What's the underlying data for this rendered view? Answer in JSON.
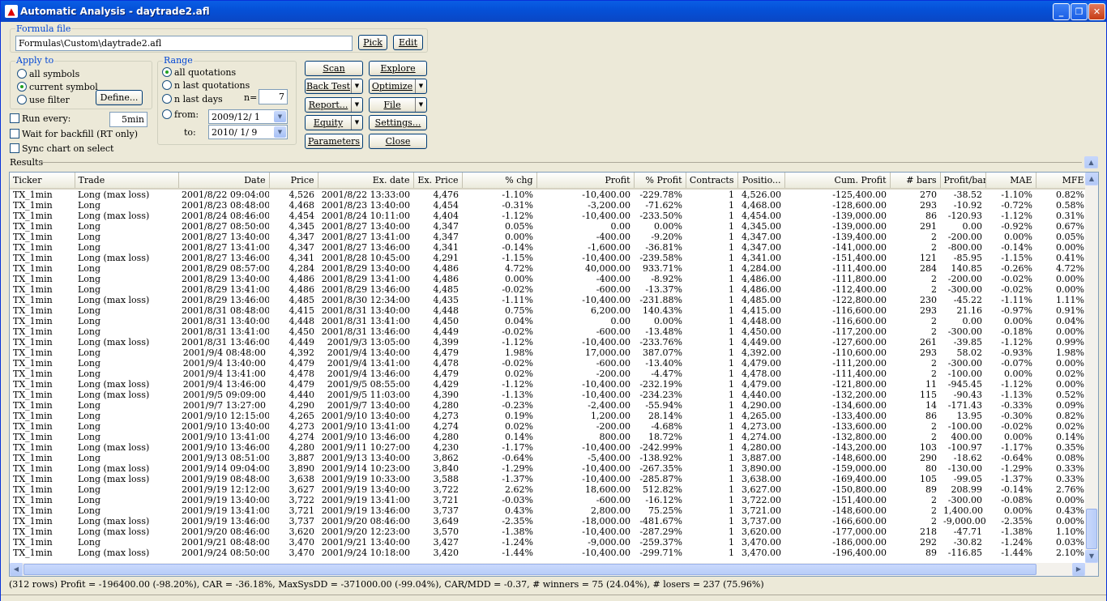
{
  "window": {
    "title": "Automatic Analysis - daytrade2.afl"
  },
  "formula": {
    "legend": "Formula file",
    "path": "Formulas\\Custom\\daytrade2.afl",
    "pick": "Pick",
    "edit": "Edit"
  },
  "apply": {
    "legend": "Apply to",
    "all": "all symbols",
    "current": "current symbol",
    "filter": "use filter",
    "define": "Define..."
  },
  "range": {
    "legend": "Range",
    "allq": "all quotations",
    "nlastq": "n last quotations",
    "nlastd": "n last days",
    "n_label": "n=",
    "n_value": "7",
    "from_label": "from:",
    "from_value": "2009/12/  1",
    "to_label": "to:",
    "to_value": "2010/  1/  9"
  },
  "actions": {
    "scan": "Scan",
    "explore": "Explore",
    "backtest": "Back Test",
    "optimize": "Optimize",
    "report": "Report...",
    "file": "File",
    "equity": "Equity",
    "settings": "Settings...",
    "parameters": "Parameters",
    "close": "Close"
  },
  "options": {
    "run_every": "Run every:",
    "run_value": "5min",
    "backfill": "Wait for backfill (RT only)",
    "sync": "Sync chart on select"
  },
  "results": {
    "label": "Results"
  },
  "columns": [
    "Ticker",
    "Trade",
    "Date",
    "Price",
    "Ex. date",
    "Ex. Price",
    "% chg",
    "Profit",
    "% Profit",
    "Contracts",
    "Positio...",
    "Cum. Profit",
    "# bars",
    "Profit/bar",
    "MAE",
    "MFE"
  ],
  "rows": [
    [
      "TX_1min",
      "Long (max loss)",
      "2001/8/22 09:04:00",
      "4,526",
      "2001/8/22 13:33:00",
      "4,476",
      "-1.10%",
      "-10,400.00",
      "-229.78%",
      "1",
      "4,526.00",
      "-125,400.00",
      "270",
      "-38.52",
      "-1.10%",
      "0.82%"
    ],
    [
      "TX_1min",
      "Long",
      "2001/8/23 08:48:00",
      "4,468",
      "2001/8/23 13:40:00",
      "4,454",
      "-0.31%",
      "-3,200.00",
      "-71.62%",
      "1",
      "4,468.00",
      "-128,600.00",
      "293",
      "-10.92",
      "-0.72%",
      "0.58%"
    ],
    [
      "TX_1min",
      "Long (max loss)",
      "2001/8/24 08:46:00",
      "4,454",
      "2001/8/24 10:11:00",
      "4,404",
      "-1.12%",
      "-10,400.00",
      "-233.50%",
      "1",
      "4,454.00",
      "-139,000.00",
      "86",
      "-120.93",
      "-1.12%",
      "0.31%"
    ],
    [
      "TX_1min",
      "Long",
      "2001/8/27 08:50:00",
      "4,345",
      "2001/8/27 13:40:00",
      "4,347",
      "0.05%",
      "0.00",
      "0.00%",
      "1",
      "4,345.00",
      "-139,000.00",
      "291",
      "0.00",
      "-0.92%",
      "0.67%"
    ],
    [
      "TX_1min",
      "Long",
      "2001/8/27 13:40:00",
      "4,347",
      "2001/8/27 13:41:00",
      "4,347",
      "0.00%",
      "-400.00",
      "-9.20%",
      "1",
      "4,347.00",
      "-139,400.00",
      "2",
      "-200.00",
      "0.00%",
      "0.05%"
    ],
    [
      "TX_1min",
      "Long",
      "2001/8/27 13:41:00",
      "4,347",
      "2001/8/27 13:46:00",
      "4,341",
      "-0.14%",
      "-1,600.00",
      "-36.81%",
      "1",
      "4,347.00",
      "-141,000.00",
      "2",
      "-800.00",
      "-0.14%",
      "0.00%"
    ],
    [
      "TX_1min",
      "Long (max loss)",
      "2001/8/27 13:46:00",
      "4,341",
      "2001/8/28 10:45:00",
      "4,291",
      "-1.15%",
      "-10,400.00",
      "-239.58%",
      "1",
      "4,341.00",
      "-151,400.00",
      "121",
      "-85.95",
      "-1.15%",
      "0.41%"
    ],
    [
      "TX_1min",
      "Long",
      "2001/8/29 08:57:00",
      "4,284",
      "2001/8/29 13:40:00",
      "4,486",
      "4.72%",
      "40,000.00",
      "933.71%",
      "1",
      "4,284.00",
      "-111,400.00",
      "284",
      "140.85",
      "-0.26%",
      "4.72%"
    ],
    [
      "TX_1min",
      "Long",
      "2001/8/29 13:40:00",
      "4,486",
      "2001/8/29 13:41:00",
      "4,486",
      "0.00%",
      "-400.00",
      "-8.92%",
      "1",
      "4,486.00",
      "-111,800.00",
      "2",
      "-200.00",
      "-0.02%",
      "0.00%"
    ],
    [
      "TX_1min",
      "Long",
      "2001/8/29 13:41:00",
      "4,486",
      "2001/8/29 13:46:00",
      "4,485",
      "-0.02%",
      "-600.00",
      "-13.37%",
      "1",
      "4,486.00",
      "-112,400.00",
      "2",
      "-300.00",
      "-0.02%",
      "0.00%"
    ],
    [
      "TX_1min",
      "Long (max loss)",
      "2001/8/29 13:46:00",
      "4,485",
      "2001/8/30 12:34:00",
      "4,435",
      "-1.11%",
      "-10,400.00",
      "-231.88%",
      "1",
      "4,485.00",
      "-122,800.00",
      "230",
      "-45.22",
      "-1.11%",
      "1.11%"
    ],
    [
      "TX_1min",
      "Long",
      "2001/8/31 08:48:00",
      "4,415",
      "2001/8/31 13:40:00",
      "4,448",
      "0.75%",
      "6,200.00",
      "140.43%",
      "1",
      "4,415.00",
      "-116,600.00",
      "293",
      "21.16",
      "-0.97%",
      "0.91%"
    ],
    [
      "TX_1min",
      "Long",
      "2001/8/31 13:40:00",
      "4,448",
      "2001/8/31 13:41:00",
      "4,450",
      "0.04%",
      "0.00",
      "0.00%",
      "1",
      "4,448.00",
      "-116,600.00",
      "2",
      "0.00",
      "0.00%",
      "0.04%"
    ],
    [
      "TX_1min",
      "Long",
      "2001/8/31 13:41:00",
      "4,450",
      "2001/8/31 13:46:00",
      "4,449",
      "-0.02%",
      "-600.00",
      "-13.48%",
      "1",
      "4,450.00",
      "-117,200.00",
      "2",
      "-300.00",
      "-0.18%",
      "0.00%"
    ],
    [
      "TX_1min",
      "Long (max loss)",
      "2001/8/31 13:46:00",
      "4,449",
      "2001/9/3 13:05:00",
      "4,399",
      "-1.12%",
      "-10,400.00",
      "-233.76%",
      "1",
      "4,449.00",
      "-127,600.00",
      "261",
      "-39.85",
      "-1.12%",
      "0.99%"
    ],
    [
      "TX_1min",
      "Long",
      "2001/9/4 08:48:00",
      "4,392",
      "2001/9/4 13:40:00",
      "4,479",
      "1.98%",
      "17,000.00",
      "387.07%",
      "1",
      "4,392.00",
      "-110,600.00",
      "293",
      "58.02",
      "-0.93%",
      "1.98%"
    ],
    [
      "TX_1min",
      "Long",
      "2001/9/4 13:40:00",
      "4,479",
      "2001/9/4 13:41:00",
      "4,478",
      "-0.02%",
      "-600.00",
      "-13.40%",
      "1",
      "4,479.00",
      "-111,200.00",
      "2",
      "-300.00",
      "-0.07%",
      "0.00%"
    ],
    [
      "TX_1min",
      "Long",
      "2001/9/4 13:41:00",
      "4,478",
      "2001/9/4 13:46:00",
      "4,479",
      "0.02%",
      "-200.00",
      "-4.47%",
      "1",
      "4,478.00",
      "-111,400.00",
      "2",
      "-100.00",
      "0.00%",
      "0.02%"
    ],
    [
      "TX_1min",
      "Long (max loss)",
      "2001/9/4 13:46:00",
      "4,479",
      "2001/9/5 08:55:00",
      "4,429",
      "-1.12%",
      "-10,400.00",
      "-232.19%",
      "1",
      "4,479.00",
      "-121,800.00",
      "11",
      "-945.45",
      "-1.12%",
      "0.00%"
    ],
    [
      "TX_1min",
      "Long (max loss)",
      "2001/9/5 09:09:00",
      "4,440",
      "2001/9/5 11:03:00",
      "4,390",
      "-1.13%",
      "-10,400.00",
      "-234.23%",
      "1",
      "4,440.00",
      "-132,200.00",
      "115",
      "-90.43",
      "-1.13%",
      "0.52%"
    ],
    [
      "TX_1min",
      "Long",
      "2001/9/7 13:27:00",
      "4,290",
      "2001/9/7 13:40:00",
      "4,280",
      "-0.23%",
      "-2,400.00",
      "-55.94%",
      "1",
      "4,290.00",
      "-134,600.00",
      "14",
      "-171.43",
      "-0.33%",
      "0.09%"
    ],
    [
      "TX_1min",
      "Long",
      "2001/9/10 12:15:00",
      "4,265",
      "2001/9/10 13:40:00",
      "4,273",
      "0.19%",
      "1,200.00",
      "28.14%",
      "1",
      "4,265.00",
      "-133,400.00",
      "86",
      "13.95",
      "-0.30%",
      "0.82%"
    ],
    [
      "TX_1min",
      "Long",
      "2001/9/10 13:40:00",
      "4,273",
      "2001/9/10 13:41:00",
      "4,274",
      "0.02%",
      "-200.00",
      "-4.68%",
      "1",
      "4,273.00",
      "-133,600.00",
      "2",
      "-100.00",
      "-0.02%",
      "0.02%"
    ],
    [
      "TX_1min",
      "Long",
      "2001/9/10 13:41:00",
      "4,274",
      "2001/9/10 13:46:00",
      "4,280",
      "0.14%",
      "800.00",
      "18.72%",
      "1",
      "4,274.00",
      "-132,800.00",
      "2",
      "400.00",
      "0.00%",
      "0.14%"
    ],
    [
      "TX_1min",
      "Long (max loss)",
      "2001/9/10 13:46:00",
      "4,280",
      "2001/9/11 10:27:00",
      "4,230",
      "-1.17%",
      "-10,400.00",
      "-242.99%",
      "1",
      "4,280.00",
      "-143,200.00",
      "103",
      "-100.97",
      "-1.17%",
      "0.35%"
    ],
    [
      "TX_1min",
      "Long",
      "2001/9/13 08:51:00",
      "3,887",
      "2001/9/13 13:40:00",
      "3,862",
      "-0.64%",
      "-5,400.00",
      "-138.92%",
      "1",
      "3,887.00",
      "-148,600.00",
      "290",
      "-18.62",
      "-0.64%",
      "0.08%"
    ],
    [
      "TX_1min",
      "Long (max loss)",
      "2001/9/14 09:04:00",
      "3,890",
      "2001/9/14 10:23:00",
      "3,840",
      "-1.29%",
      "-10,400.00",
      "-267.35%",
      "1",
      "3,890.00",
      "-159,000.00",
      "80",
      "-130.00",
      "-1.29%",
      "0.33%"
    ],
    [
      "TX_1min",
      "Long (max loss)",
      "2001/9/19 08:48:00",
      "3,638",
      "2001/9/19 10:33:00",
      "3,588",
      "-1.37%",
      "-10,400.00",
      "-285.87%",
      "1",
      "3,638.00",
      "-169,400.00",
      "105",
      "-99.05",
      "-1.37%",
      "0.33%"
    ],
    [
      "TX_1min",
      "Long",
      "2001/9/19 12:12:00",
      "3,627",
      "2001/9/19 13:40:00",
      "3,722",
      "2.62%",
      "18,600.00",
      "512.82%",
      "1",
      "3,627.00",
      "-150,800.00",
      "89",
      "208.99",
      "-0.14%",
      "2.76%"
    ],
    [
      "TX_1min",
      "Long",
      "2001/9/19 13:40:00",
      "3,722",
      "2001/9/19 13:41:00",
      "3,721",
      "-0.03%",
      "-600.00",
      "-16.12%",
      "1",
      "3,722.00",
      "-151,400.00",
      "2",
      "-300.00",
      "-0.08%",
      "0.00%"
    ],
    [
      "TX_1min",
      "Long",
      "2001/9/19 13:41:00",
      "3,721",
      "2001/9/19 13:46:00",
      "3,737",
      "0.43%",
      "2,800.00",
      "75.25%",
      "1",
      "3,721.00",
      "-148,600.00",
      "2",
      "1,400.00",
      "0.00%",
      "0.43%"
    ],
    [
      "TX_1min",
      "Long (max loss)",
      "2001/9/19 13:46:00",
      "3,737",
      "2001/9/20 08:46:00",
      "3,649",
      "-2.35%",
      "-18,000.00",
      "-481.67%",
      "1",
      "3,737.00",
      "-166,600.00",
      "2",
      "-9,000.00",
      "-2.35%",
      "0.00%"
    ],
    [
      "TX_1min",
      "Long (max loss)",
      "2001/9/20 08:46:00",
      "3,620",
      "2001/9/20 12:23:00",
      "3,570",
      "-1.38%",
      "-10,400.00",
      "-287.29%",
      "1",
      "3,620.00",
      "-177,000.00",
      "218",
      "-47.71",
      "-1.38%",
      "1.10%"
    ],
    [
      "TX_1min",
      "Long",
      "2001/9/21 08:48:00",
      "3,470",
      "2001/9/21 13:40:00",
      "3,427",
      "-1.24%",
      "-9,000.00",
      "-259.37%",
      "1",
      "3,470.00",
      "-186,000.00",
      "292",
      "-30.82",
      "-1.24%",
      "0.03%"
    ],
    [
      "TX_1min",
      "Long (max loss)",
      "2001/9/24 08:50:00",
      "3,470",
      "2001/9/24 10:18:00",
      "3,420",
      "-1.44%",
      "-10,400.00",
      "-299.71%",
      "1",
      "3,470.00",
      "-196,400.00",
      "89",
      "-116.85",
      "-1.44%",
      "2.10%"
    ]
  ],
  "status": "(312 rows) Profit = -196400.00 (-98.20%), CAR = -36.18%, MaxSysDD = -371000.00 (-99.04%), CAR/MDD = -0.37, # winners = 75 (24.04%), # losers = 237 (75.96%)"
}
